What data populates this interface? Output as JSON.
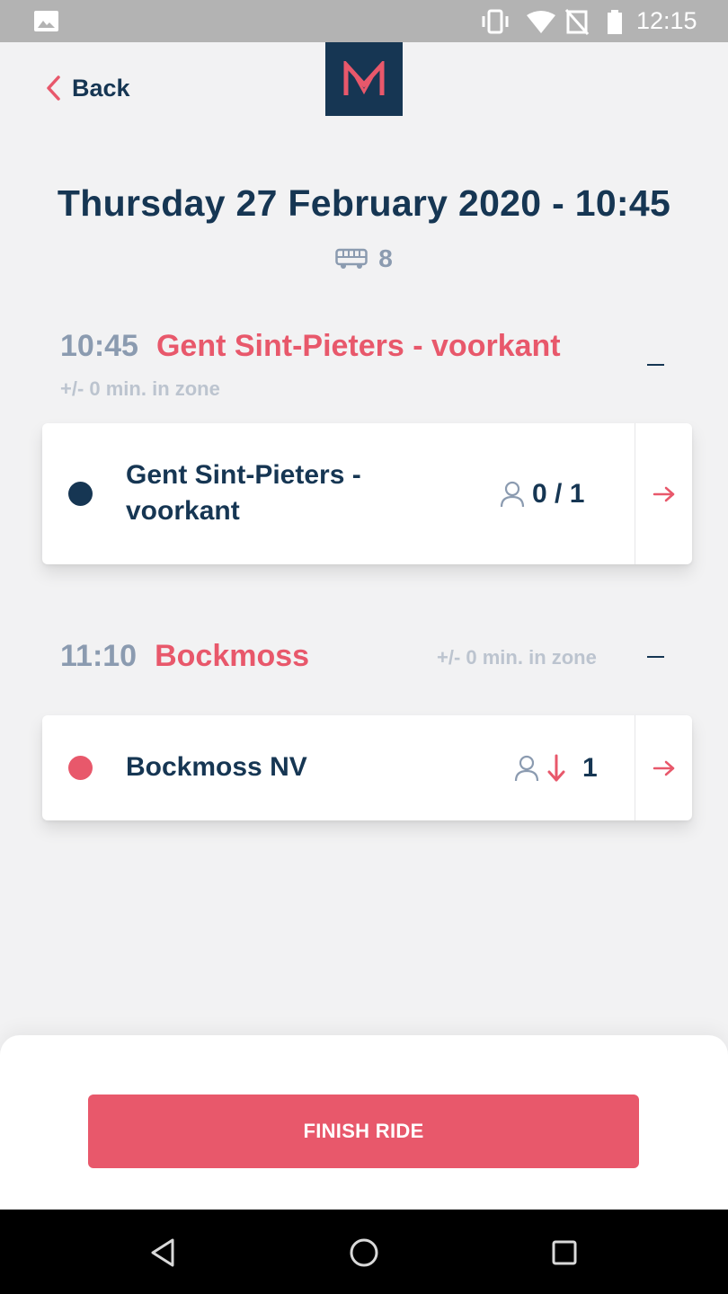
{
  "status_bar": {
    "time": "12:15"
  },
  "header": {
    "back_label": "Back",
    "logo_letter": "M"
  },
  "ride": {
    "title": "Thursday 27 February 2020 - 10:45",
    "vehicle_count": "8"
  },
  "stops": [
    {
      "time": "10:45",
      "name": "Gent Sint-Pieters - voorkant",
      "zone_text": "+/- 0 min. in zone",
      "card": {
        "name_line1": "Gent Sint-Pieters -",
        "name_line2": "voorkant",
        "passengers": "0 / 1",
        "dot_color": "#163653"
      }
    },
    {
      "time": "11:10",
      "name": "Bockmoss",
      "zone_text": "+/- 0 min. in zone",
      "card": {
        "name_line1": "Bockmoss NV",
        "passengers": "1",
        "dot_color": "#e8586b",
        "direction": "drop-off"
      }
    }
  ],
  "footer": {
    "finish_label": "FINISH RIDE"
  },
  "colors": {
    "accent": "#e8586b",
    "brand": "#163653",
    "muted": "#8b9bb0"
  }
}
